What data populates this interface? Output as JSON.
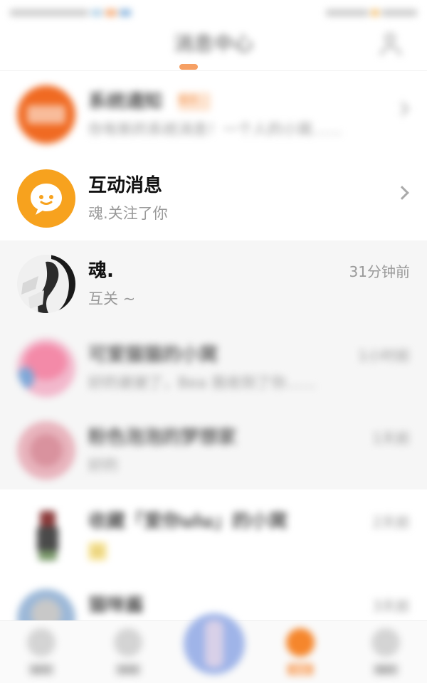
{
  "header": {
    "title": "消息中心",
    "contacts_icon": "contacts-icon"
  },
  "rows": {
    "system": {
      "title": "系统通知",
      "badge": "官方",
      "preview": "你有新的系统消息！一个人的小窝……",
      "icon": "system-notice-icon"
    },
    "interaction": {
      "title": "互动消息",
      "preview": "魂.关注了你",
      "icon": "chat-bubble-icon"
    },
    "chat1": {
      "title": "魂.",
      "preview": "互关 ~",
      "time": "31分钟前"
    },
    "chat2": {
      "title": "可爱猫猫的小窝",
      "preview": "好的谢谢了，Bea 我收到了你……",
      "time": "1小时前"
    },
    "chat3": {
      "title": "粉色泡泡的梦想家",
      "preview": "好的",
      "time": "1天前"
    },
    "chat4": {
      "title": "收藏「爱你ulu」的小窝",
      "preview": "☺",
      "time": "2天前"
    },
    "chat5": {
      "title": "猫咪酱",
      "time": "3天前"
    }
  },
  "nav": {
    "home": "首页",
    "discover": "发现",
    "messages": "消息",
    "mine": "我的"
  },
  "colors": {
    "accent": "#f5862c",
    "background": "#ffffff",
    "highlight_row": "#f6f6f6"
  }
}
